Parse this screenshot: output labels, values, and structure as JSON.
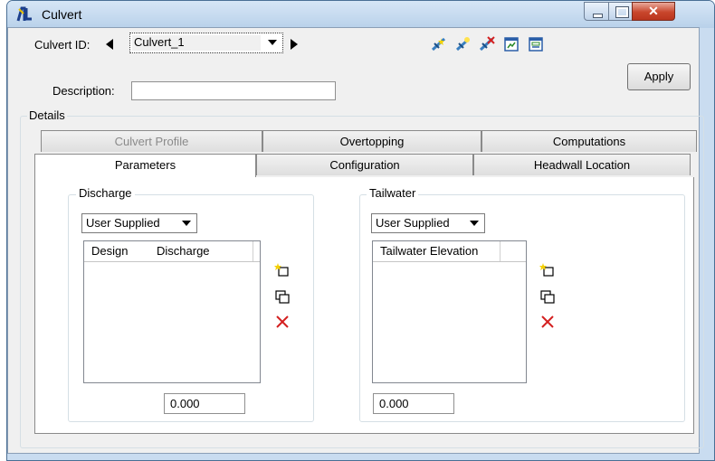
{
  "window": {
    "title": "Culvert"
  },
  "header": {
    "culvert_id_label": "Culvert ID:",
    "culvert_id_value": "Culvert_1",
    "description_label": "Description:",
    "description_value": "",
    "apply_label": "Apply"
  },
  "toolbar_icons": [
    "add-culvert-icon",
    "edit-culvert-icon",
    "delete-culvert-icon",
    "profile-view-icon",
    "report-view-icon"
  ],
  "details": {
    "label": "Details",
    "tabs_back": [
      {
        "label": "Culvert Profile",
        "disabled": true
      },
      {
        "label": "Overtopping"
      },
      {
        "label": "Computations"
      }
    ],
    "tabs_front": [
      {
        "label": "Parameters",
        "active": true
      },
      {
        "label": "Configuration"
      },
      {
        "label": "Headwall Location"
      }
    ]
  },
  "discharge": {
    "group_label": "Discharge",
    "mode": "User Supplied",
    "columns": [
      "Design",
      "Discharge"
    ],
    "rows": [],
    "value": "0.000"
  },
  "tailwater": {
    "group_label": "Tailwater",
    "mode": "User Supplied",
    "columns": [
      "Tailwater Elevation"
    ],
    "rows": [],
    "value": "0.000"
  },
  "colors": {
    "window_frame": "#c9dcf0",
    "close_button": "#c9462c",
    "dialog_bg": "#f0f0f0",
    "delete_red": "#d42020"
  }
}
